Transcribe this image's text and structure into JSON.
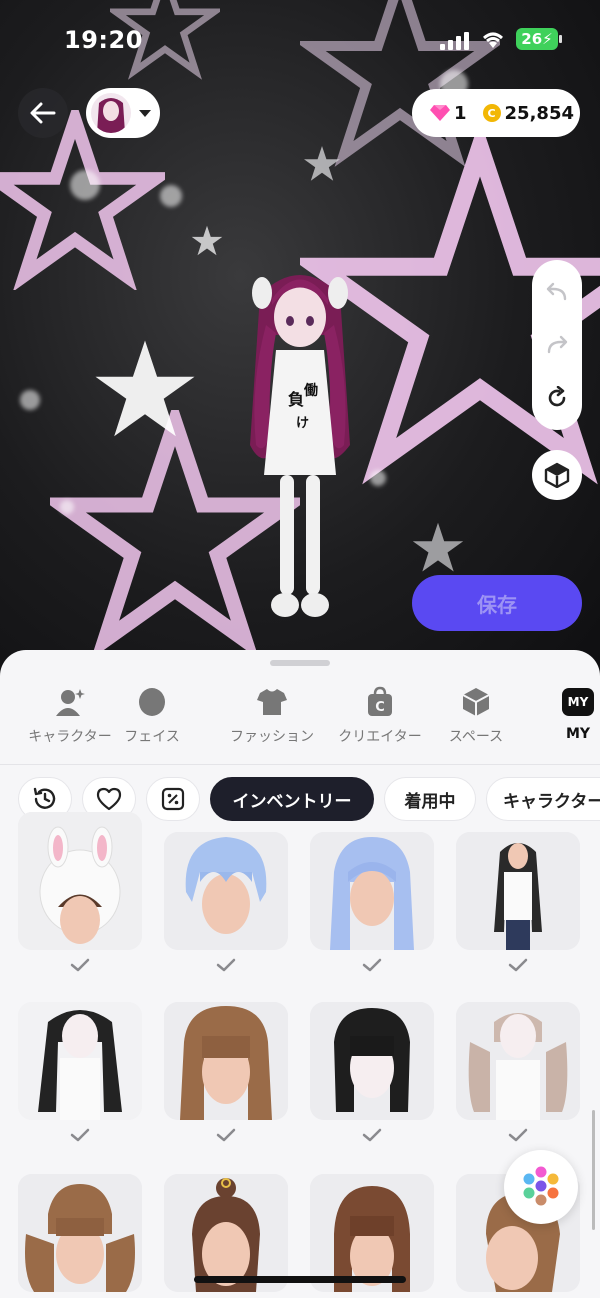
{
  "status_bar": {
    "time": "19:20",
    "battery": "26"
  },
  "header": {
    "gem_count": "1",
    "coin_symbol": "C",
    "coin_count": "25,854"
  },
  "actions": {
    "save_label": "保存"
  },
  "categories": [
    {
      "label": "キャラクター",
      "icon": "character-icon"
    },
    {
      "label": "フェイス",
      "icon": "face-icon"
    },
    {
      "label": "ファッション",
      "icon": "tshirt-icon"
    },
    {
      "label": "クリエイター",
      "icon": "creator-bag-icon"
    },
    {
      "label": "スペース",
      "icon": "space-cube-icon"
    },
    {
      "label": "MY",
      "icon": "my-badge-icon",
      "badge": "MY",
      "active": true
    }
  ],
  "filters": {
    "icons": [
      "history-icon",
      "heart-icon",
      "coupon-icon"
    ],
    "tabs": [
      {
        "label": "インベントリー",
        "active": true
      },
      {
        "label": "着用中"
      },
      {
        "label": "キャラクター"
      }
    ]
  },
  "items": [
    {
      "name": "bunny-hood-hair",
      "checked": true
    },
    {
      "name": "blue-spiky-hair",
      "checked": true
    },
    {
      "name": "blue-long-hair",
      "checked": true
    },
    {
      "name": "black-long-wavy-hair",
      "checked": true
    },
    {
      "name": "black-wavy-bangs-hair",
      "checked": true
    },
    {
      "name": "brown-long-hair",
      "checked": true
    },
    {
      "name": "black-bob-hair",
      "checked": true
    },
    {
      "name": "ash-twin-tail-hair",
      "checked": true
    },
    {
      "name": "brown-twin-tail-hair",
      "checked": false
    },
    {
      "name": "brown-bun-hair",
      "checked": false
    },
    {
      "name": "brown-bob-hair",
      "checked": false
    },
    {
      "name": "brown-ponytail-hair",
      "checked": false
    }
  ],
  "colors": {
    "accent": "#5a49f2",
    "active_chip": "#1e1f2b",
    "star_glow": "#f3c8f0",
    "battery": "#3fd15b"
  }
}
